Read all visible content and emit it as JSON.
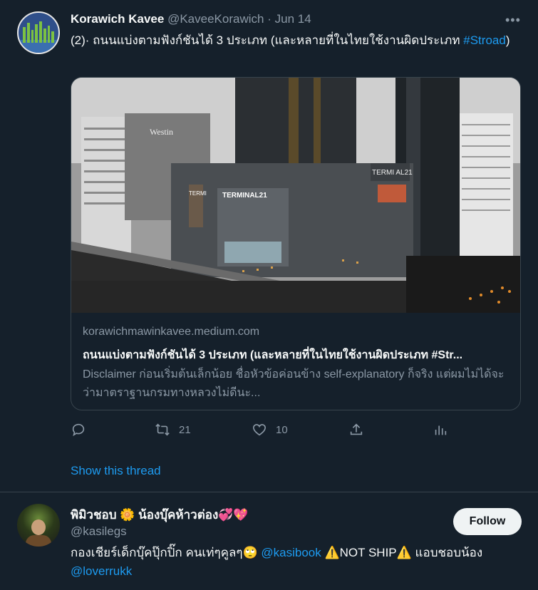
{
  "tweet": {
    "author_name": "Korawich Kavee",
    "author_handle": "@KaveeKorawich",
    "separator": "·",
    "date": "Jun 14",
    "more_icon": "more-horizontal-icon",
    "text_before": "(2)· ถนนแบ่งตามฟังก์ชันได้ 3 ประเภท (และหลายที่ในไทยใช้งานผิดประเภท ",
    "hashtag": "#Stroad",
    "text_after": ")",
    "card": {
      "image_signage_1": "TERMINAL21",
      "image_signage_2": "TERMI AL21",
      "image_signage_3": "Westin",
      "image_signage_4": "TERMI",
      "domain": "korawichmawinkavee.medium.com",
      "title": "ถนนแบ่งตามฟังก์ชันได้ 3 ประเภท (และหลายที่ในไทยใช้งานผิดประเภท #Str...",
      "description": "Disclaimer ก่อนเริ่มต้นเล็กน้อย ชื่อหัวข้อค่อนข้าง self-explanatory ก็จริง แต่ผมไม่ได้จะว่ามาตราฐานกรมทางหลวงไม่ดีนะ..."
    },
    "actions": {
      "reply_icon": "reply-icon",
      "reply_count": "",
      "retweet_icon": "retweet-icon",
      "retweet_count": "21",
      "like_icon": "heart-icon",
      "like_count": "10",
      "share_icon": "share-icon",
      "analytics_icon": "analytics-icon"
    },
    "show_thread": "Show this thread"
  },
  "suggested_user": {
    "name": "พิมิวชอบ 🌼 น้องบุ๊คห้าวต่อง💞💖",
    "handle": "@kasilegs",
    "follow_label": "Follow",
    "bio_before": "กองเชียร์เด็กบุ๊คปุ๊กปิ๊ก คนเท่ๆคูลๆ🙄 ",
    "bio_mention_1": "@kasibook",
    "bio_middle": " ⚠️NOT SHIP⚠️ แอบชอบน้อง ",
    "bio_mention_2": "@loverrukk"
  },
  "colors": {
    "background": "#15202b",
    "text": "#f7f9f9",
    "muted": "#8b98a5",
    "accent": "#1d9bf0",
    "border": "#38444d"
  }
}
